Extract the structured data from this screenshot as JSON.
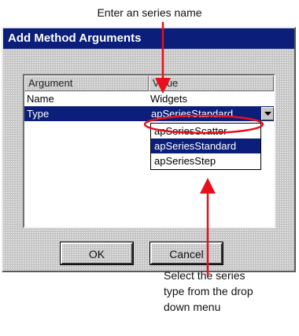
{
  "callouts": {
    "top": "Enter an series name",
    "bottom": "Select the series\ntype from the drop\ndown menu"
  },
  "dialog": {
    "title": "Add Method Arguments",
    "columns": [
      "Argument",
      "Value"
    ],
    "rows": [
      {
        "argument": "Name",
        "value": "Widgets"
      },
      {
        "argument": "Type",
        "value": "apSeriesStandard"
      }
    ],
    "dropdown": {
      "options": [
        "apSeriesScatter",
        "apSeriesStandard",
        "apSeriesStep"
      ],
      "selected": "apSeriesStandard"
    },
    "buttons": {
      "ok": "OK",
      "cancel": "Cancel"
    }
  },
  "colors": {
    "title_bar": "#0b1f7a",
    "selection": "#0b1f7a",
    "annotation": "#e8101a",
    "dialog_face": "#c6c6c6"
  },
  "icons": {
    "dropdown_button": "chevron-down-icon"
  }
}
